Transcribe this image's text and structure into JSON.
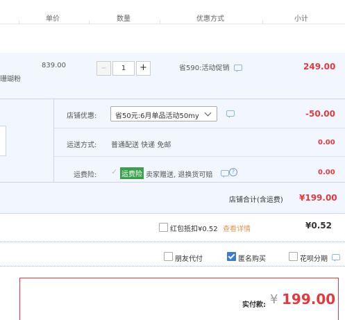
{
  "header": {
    "col_unit_price": "单价",
    "col_quantity": "数量",
    "col_discount": "优惠方式",
    "col_subtotal": "小计"
  },
  "item": {
    "color_fragment": "珊瑚粉",
    "unit_price": "839.00",
    "quantity": "1",
    "minus": "−",
    "plus": "+",
    "discount": "省590:活动促销",
    "subtotal": "249.00"
  },
  "shop": {
    "coupon_label": "店铺优惠:",
    "coupon_value": "省50元:6月单品活动50my",
    "coupon_amount": "-50.00",
    "shipping_label": "运送方式:",
    "shipping_value": "普通配送 快递 免邮",
    "shipping_amount": "0.00",
    "insurance_label": "运费险:",
    "insurance_badge": "运费险",
    "insurance_text": "卖家赠送, 退换货可赔",
    "insurance_amount": "0.00",
    "total_label": "店铺合计(含运费)",
    "total_value": "¥199.00"
  },
  "redpacket": {
    "label": "红包抵扣¥0.52",
    "link": "查看详情",
    "amount": "¥0.52"
  },
  "options": {
    "friend_pay": "朋友代付",
    "anonymous": "匿名购买",
    "huabei": "花呗分期"
  },
  "payment": {
    "label": "实付款:",
    "currency": "¥",
    "amount": "199.00"
  },
  "colors": {
    "accent_red": "#e4393c",
    "badge_green": "#3aa14a",
    "row_bg": "#f2f7ff",
    "checkbox_blue": "#3a7bd5"
  }
}
